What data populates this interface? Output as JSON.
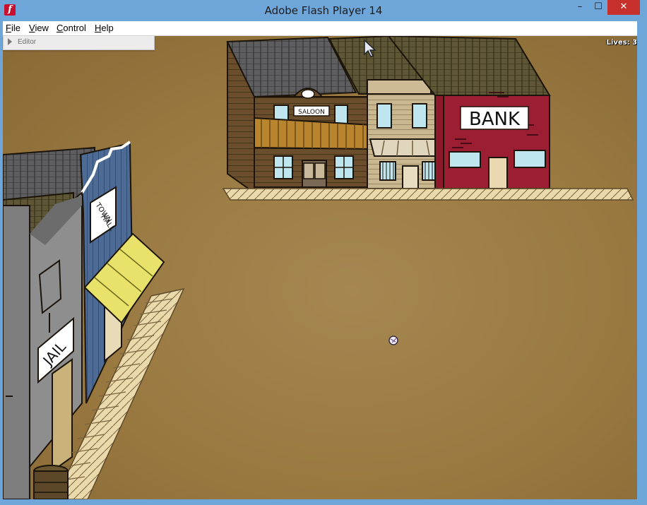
{
  "window": {
    "title": "Adobe Flash Player 14",
    "controls": {
      "minimize": "–",
      "maximize": "☐",
      "close": "✕"
    }
  },
  "menu": {
    "items": [
      {
        "label": "File",
        "underline": "F"
      },
      {
        "label": "View",
        "underline": "V"
      },
      {
        "label": "Control",
        "underline": "C"
      },
      {
        "label": "Help",
        "underline": "H"
      }
    ]
  },
  "editor_panel": {
    "label": "Editor"
  },
  "hud": {
    "lives_text": "Lives: 3"
  },
  "buildings": {
    "saloon_sign": "SALOON",
    "bank_sign": "BANK",
    "town_hall_sign_line1": "TOWN",
    "town_hall_sign_line2": "HALL",
    "jail_sign": "JAIL"
  },
  "colors": {
    "ground": "#9a7a45",
    "bank_red": "#9b1e32",
    "saloon_brown": "#6b4f2c",
    "townhall_blue": "#4a6a93",
    "jail_gray": "#8e8e8e",
    "awning_yellow": "#e8e26a",
    "boardwalk": "#e8d9a8"
  }
}
